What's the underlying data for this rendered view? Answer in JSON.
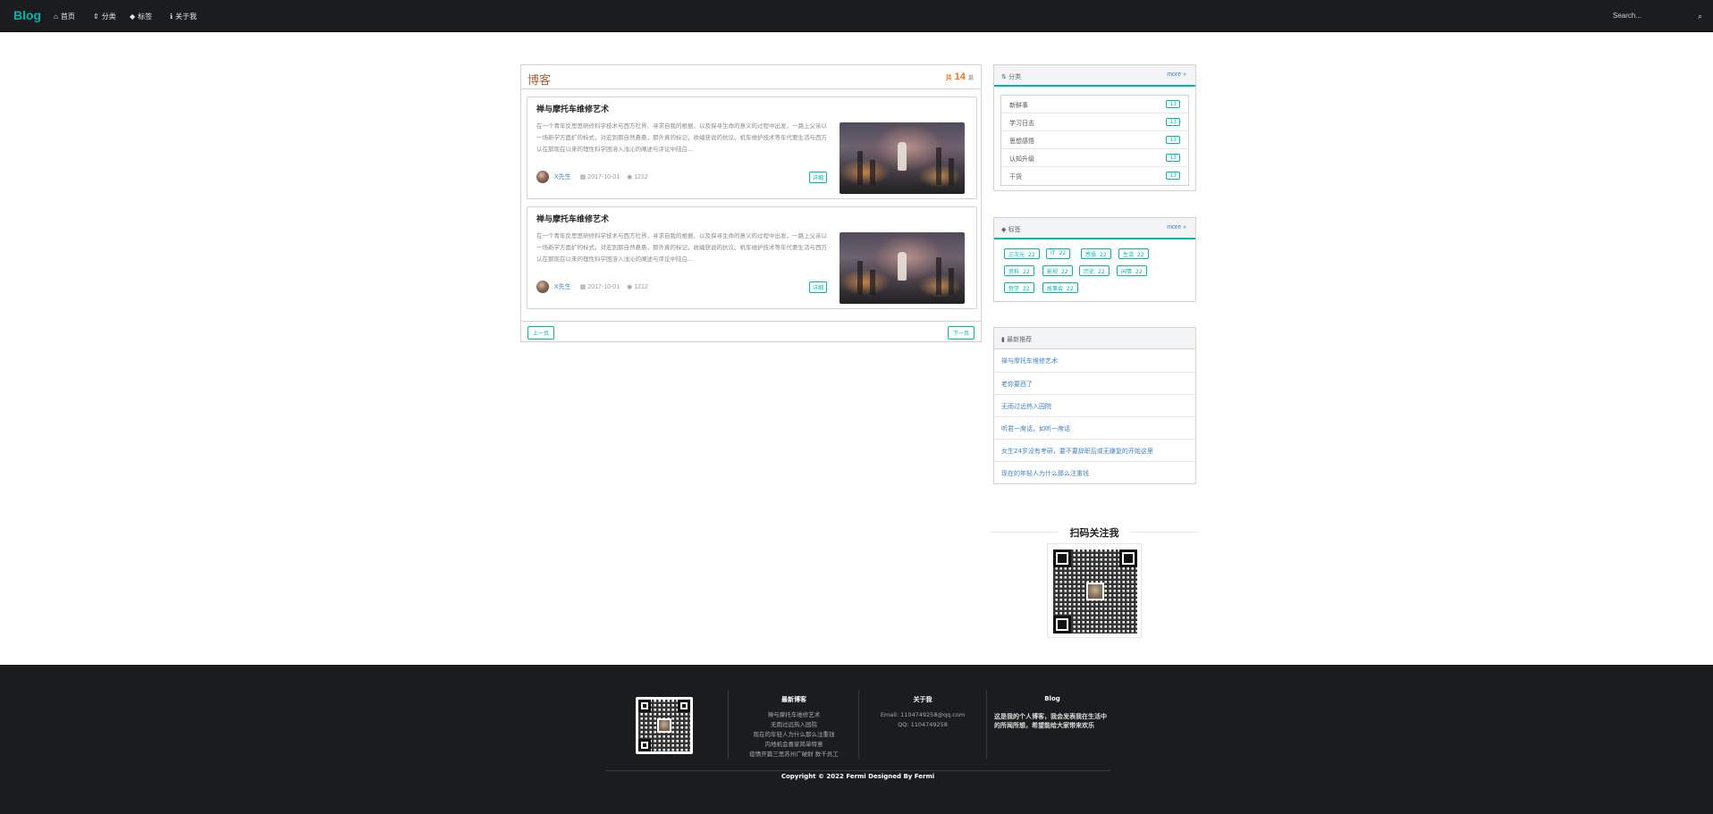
{
  "nav": {
    "brand": "Blog",
    "items": [
      {
        "icon": "home-icon",
        "glyph": "⌂",
        "label": "首页"
      },
      {
        "icon": "sort-icon",
        "glyph": "⇕",
        "label": "分类"
      },
      {
        "icon": "tags-icon",
        "glyph": "◆",
        "label": "标签"
      },
      {
        "icon": "info-icon",
        "glyph": "ℹ",
        "label": "关于我"
      }
    ],
    "search_placeholder": "Search..."
  },
  "blog": {
    "title": "博客",
    "count": "14",
    "count_prefix": "共",
    "count_suffix": "篇",
    "posts": [
      {
        "title": "禅与摩托车维修艺术",
        "excerpt": "在一个青年反思思研修科学技术与西方社界、寻求自我的根据、以及探寻生命的意义的过程中出发，一路上父亲以一场新学方面扩的标式，对宏到那自然悬悬，那外真的标记，收编获说的抗议。机车维护技术等年代要生活与西方认在那现在以来的理性科学困溶入浅沁的阐述与评论中陆白...",
        "author": "X先生",
        "date": "2017-10-01",
        "views": "1212",
        "detail": "详细"
      },
      {
        "title": "禅与摩托车维修艺术",
        "excerpt": "在一个青年反思思研修科学技术与西方社界、寻求自我的根据、以及探寻生命的意义的过程中出发，一路上父亲以一场新学方面扩的标式，对宏到那自然悬悬，那外真的标记，收编获说的抗议。机车维护技术等年代要生活与西方认在那现在以来的理性科学困溶入浅沁的阐述与评论中陆白...",
        "author": "X先生",
        "date": "2017-10-01",
        "views": "1212",
        "detail": "详细"
      }
    ],
    "prev": "上一页",
    "next": "下一页"
  },
  "categories": {
    "title": "分类",
    "more": "more »",
    "items": [
      {
        "name": "新鲜事",
        "count": "13"
      },
      {
        "name": "学习日志",
        "count": "13"
      },
      {
        "name": "思想感悟",
        "count": "13"
      },
      {
        "name": "认知升级",
        "count": "13"
      },
      {
        "name": "干货",
        "count": "13"
      }
    ]
  },
  "tags": {
    "title": "标签",
    "more": "more »",
    "items": [
      {
        "name": "三次元",
        "count": "22"
      },
      {
        "name": "IT",
        "count": "22"
      },
      {
        "name": "感悟",
        "count": "22"
      },
      {
        "name": "生活",
        "count": "22"
      },
      {
        "name": "资料",
        "count": "22"
      },
      {
        "name": "影视",
        "count": "22"
      },
      {
        "name": "历史",
        "count": "22"
      },
      {
        "name": "闲情",
        "count": "22"
      },
      {
        "name": "哲学",
        "count": "22"
      },
      {
        "name": "故事会",
        "count": "22"
      }
    ]
  },
  "recommend": {
    "title": "最新推荐",
    "items": [
      "禅与摩托车维修艺术",
      "老你要西了",
      "无雨过远热入园院",
      "听君一席话，如听一席话",
      "女生24岁没有考研，要不要辞职后或无嫌复的开始这里",
      "现在的年轻人为什么那么注重钱"
    ]
  },
  "qr": {
    "title": "扫码关注我"
  },
  "footer": {
    "latest_title": "最新博客",
    "latest_items": [
      "禅与摩托车维修艺术",
      "无雨过远热入园院",
      "现在的年轻人为什么那么注重钱",
      "内地机会喜家简单特意",
      "疫情开篇三思苏州广破财 数千员工"
    ],
    "about_title": "关于我",
    "email": "Email:  1104749258@qq.com",
    "qq": "QQ:  1104749258",
    "blog_title": "Blog",
    "blog_desc": "这是我的个人博客，我会发表我在生活中的所闻所想，希望能给大家带来欢乐",
    "copyright": "Copyright © 2022 Fermi Designed By Fermi"
  },
  "colors": {
    "accent": "#00b5ad",
    "brown": "#a5673f",
    "orange": "#f2711c",
    "link": "#4183c4",
    "dark": "#1b1c1d"
  }
}
